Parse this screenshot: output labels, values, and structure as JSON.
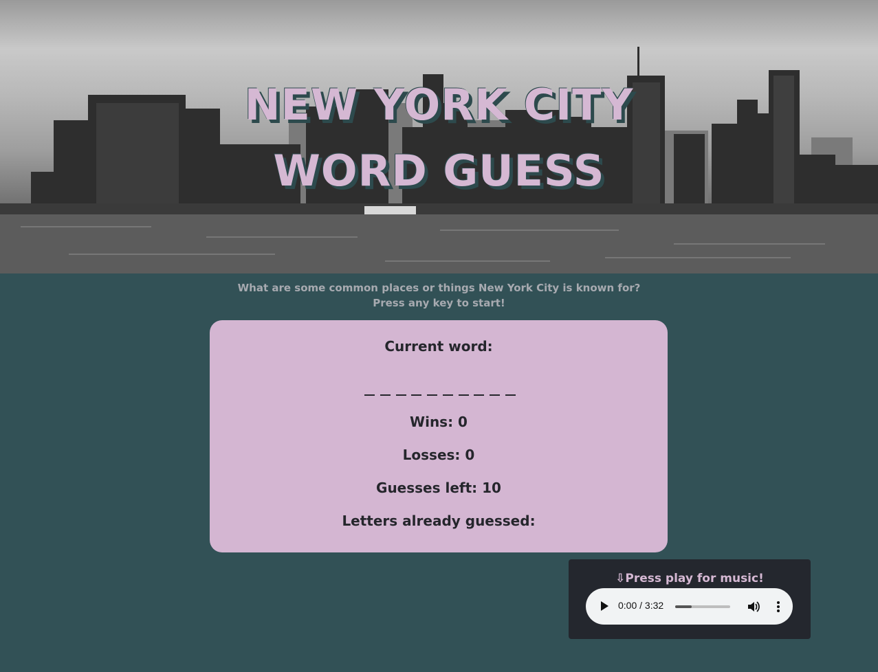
{
  "header": {
    "title_line1": "NEW YORK CITY",
    "title_line2": "WORD GUESS"
  },
  "intro": {
    "line1": "What are some common places or things New York City is known for?",
    "line2": "Press any key to start!"
  },
  "game": {
    "current_word_label": "Current word:",
    "blank_count": 10,
    "wins_text": "Wins: 0",
    "losses_text": "Losses: 0",
    "guesses_left_text": "Guesses left: 10",
    "letters_guessed_text": "Letters already guessed:"
  },
  "music": {
    "label": "⇩Press play for music!",
    "time": "0:00 / 3:32",
    "progress": 0.3,
    "icons": [
      "play-icon",
      "volume-icon",
      "more-options-icon"
    ]
  },
  "colors": {
    "background": "#325156",
    "title": "#d5b8d3",
    "card": "#d4b6d2",
    "card_text": "#25262c",
    "music_panel": "#24272e"
  }
}
